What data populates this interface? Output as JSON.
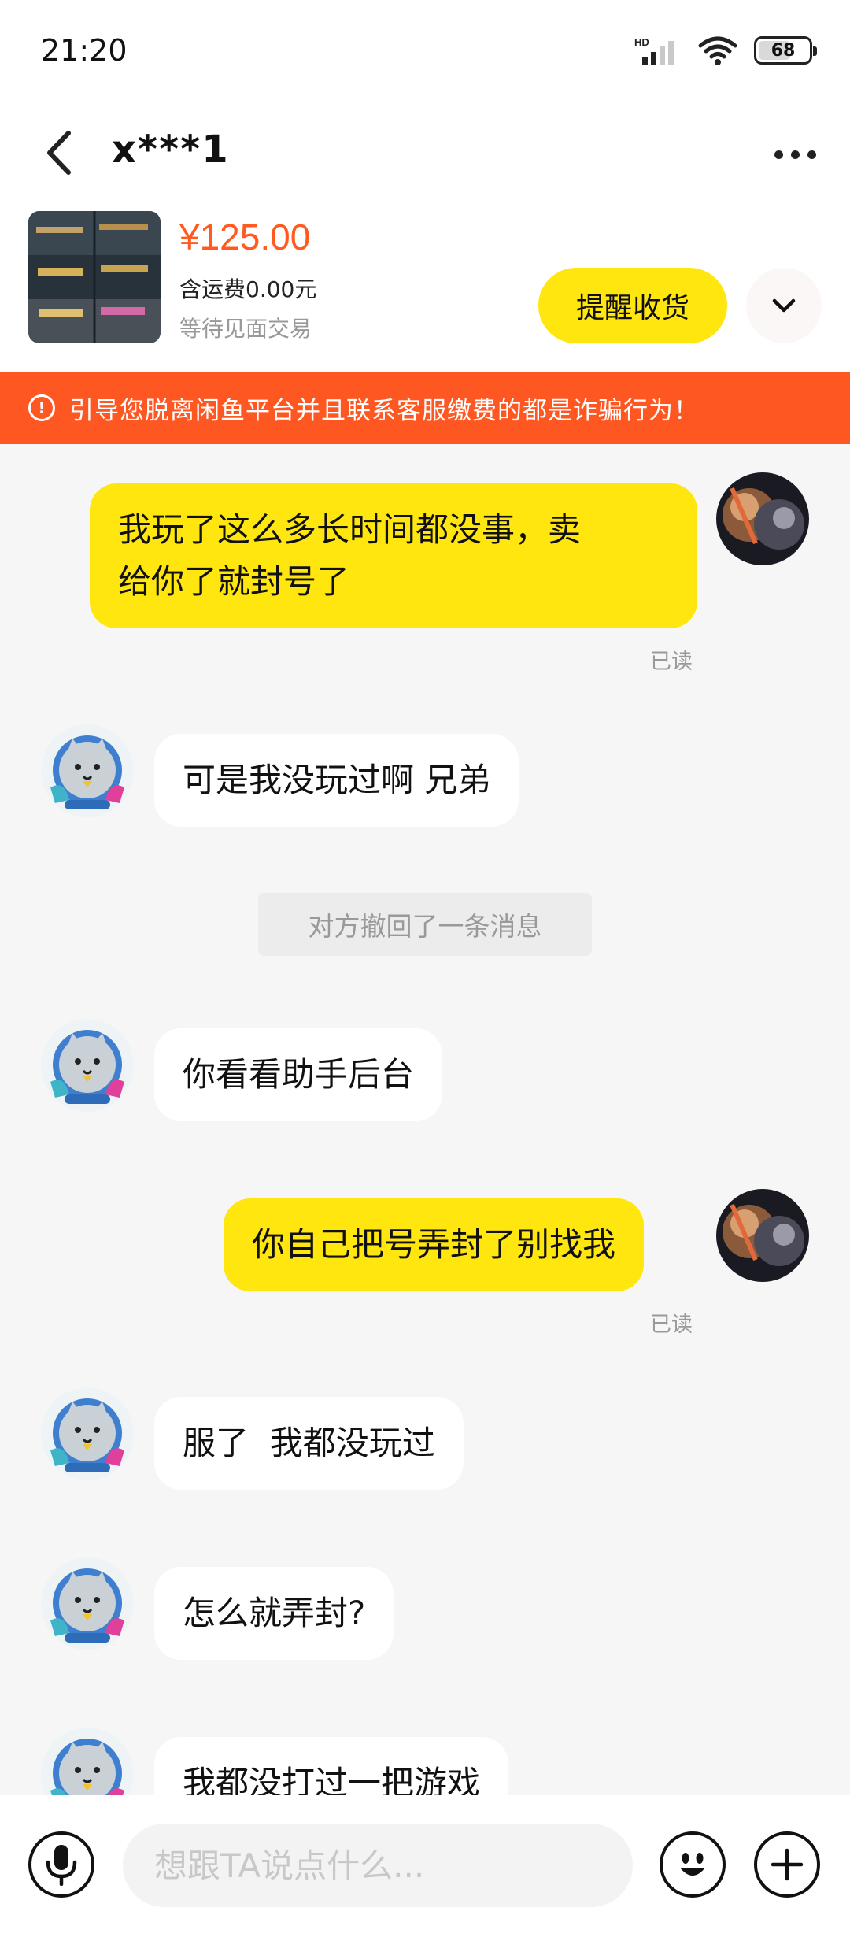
{
  "status_bar": {
    "time": "21:20",
    "battery": "68",
    "battery_level": 0.68,
    "network": "HD"
  },
  "nav": {
    "title": "x***1"
  },
  "product": {
    "price": "¥125.00",
    "shipping": "含运费0.00元",
    "status": "等待见面交易",
    "remind_button": "提醒收货"
  },
  "warning": {
    "text": "引导您脱离闲鱼平台并且联系客服缴费的都是诈骗行为！"
  },
  "messages": [
    {
      "sender": "me",
      "line1": "我玩了这么多长时间都没事，卖",
      "line2": "给你了就封号了",
      "read": "已读"
    },
    {
      "sender": "other",
      "text": "可是我没玩过啊 兄弟"
    },
    {
      "sender": "system",
      "text": "对方撤回了一条消息"
    },
    {
      "sender": "other",
      "text": "你看看助手后台"
    },
    {
      "sender": "me",
      "text": "你自己把号弄封了别找我",
      "read": "已读"
    },
    {
      "sender": "other",
      "text": "服了  我都没玩过"
    },
    {
      "sender": "other",
      "text": "怎么就弄封?"
    },
    {
      "sender": "other",
      "text": "我都没打过一把游戏"
    }
  ],
  "input": {
    "placeholder": "想跟TA说点什么..."
  },
  "colors": {
    "accent_yellow": "#ffe60f",
    "warning_orange": "#ff5722",
    "price_orange": "#ff5a1f"
  }
}
